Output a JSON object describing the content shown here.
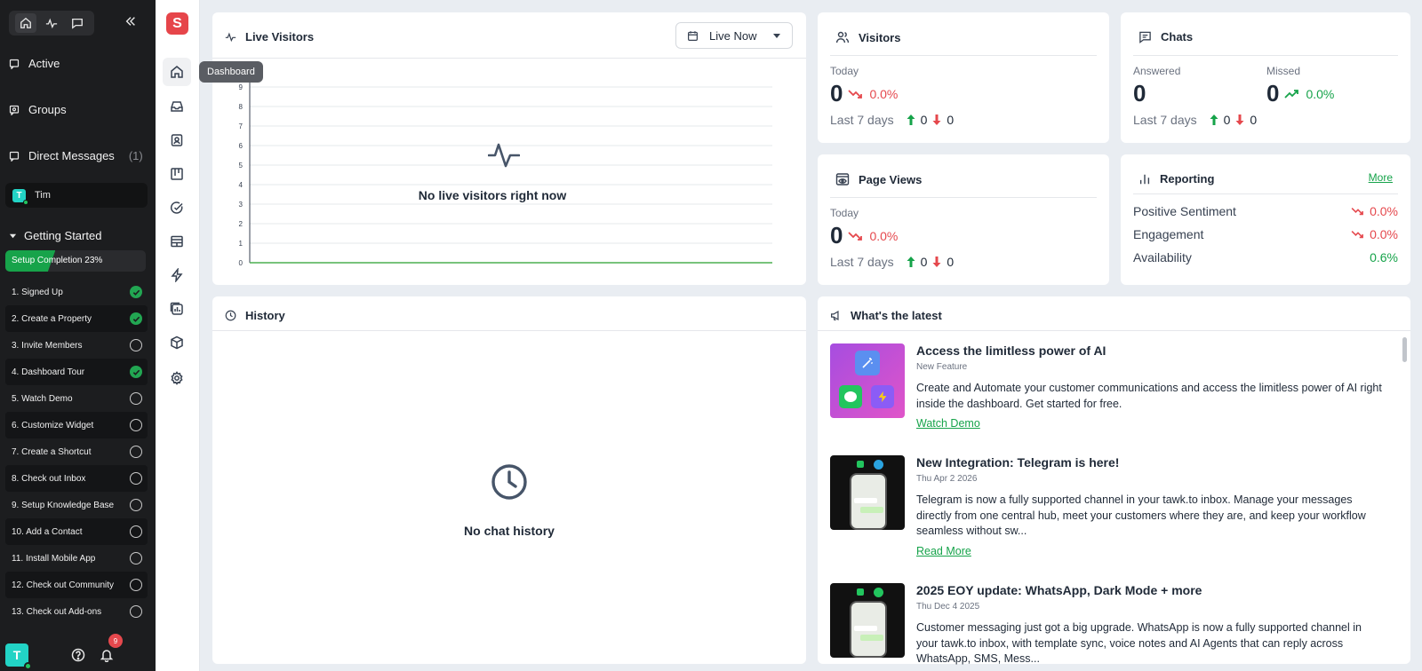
{
  "sidebar": {
    "nav": [
      {
        "label": "Active",
        "count": ""
      },
      {
        "label": "Groups",
        "count": ""
      },
      {
        "label": "Direct Messages",
        "count": "(1)"
      }
    ],
    "dm_user": {
      "initial": "T",
      "name": "Tim"
    },
    "getting_started": {
      "title": "Getting Started",
      "progress_label": "Setup Completion 23%",
      "progress_percent": 23,
      "steps": [
        {
          "label": "1. Signed Up",
          "done": true
        },
        {
          "label": "2. Create a Property",
          "done": true
        },
        {
          "label": "3. Invite Members",
          "done": false
        },
        {
          "label": "4. Dashboard Tour",
          "done": true
        },
        {
          "label": "5. Watch Demo",
          "done": false
        },
        {
          "label": "6. Customize Widget",
          "done": false
        },
        {
          "label": "7. Create a Shortcut",
          "done": false
        },
        {
          "label": "8. Check out Inbox",
          "done": false
        },
        {
          "label": "9. Setup Knowledge Base",
          "done": false
        },
        {
          "label": "10. Add a Contact",
          "done": false
        },
        {
          "label": "11. Install Mobile App",
          "done": false
        },
        {
          "label": "12. Check out Community",
          "done": false
        },
        {
          "label": "13. Check out Add-ons",
          "done": false
        }
      ]
    },
    "user_initial": "T",
    "notification_count": "9"
  },
  "rail": {
    "logo": "S",
    "tooltip": "Dashboard",
    "icons": [
      "home-icon",
      "inbox-icon",
      "contacts-icon",
      "board-icon",
      "tasks-icon",
      "knowledge-base-icon",
      "shortcuts-icon",
      "reports-icon",
      "addons-icon",
      "settings-icon"
    ]
  },
  "live_visitors": {
    "title": "Live Visitors",
    "dropdown": "Live Now",
    "empty": "No live visitors right now",
    "y_ticks": [
      "0",
      "1",
      "2",
      "3",
      "4",
      "5",
      "6",
      "7",
      "8",
      "9"
    ]
  },
  "visitors": {
    "title": "Visitors",
    "today_label": "Today",
    "today_value": "0",
    "today_change": "0.0%",
    "last7_label": "Last 7 days",
    "last7_up": "0",
    "last7_down": "0"
  },
  "chats": {
    "title": "Chats",
    "answered_label": "Answered",
    "answered_value": "0",
    "missed_label": "Missed",
    "missed_value": "0",
    "missed_change": "0.0%",
    "last7_label": "Last 7 days",
    "last7_up": "0",
    "last7_down": "0"
  },
  "page_views": {
    "title": "Page Views",
    "today_label": "Today",
    "today_value": "0",
    "today_change": "0.0%",
    "last7_label": "Last 7 days",
    "last7_up": "0",
    "last7_down": "0"
  },
  "reporting": {
    "title": "Reporting",
    "more": "More",
    "rows": [
      {
        "label": "Positive Sentiment",
        "value": "0.0%",
        "trend": "down"
      },
      {
        "label": "Engagement",
        "value": "0.0%",
        "trend": "down"
      },
      {
        "label": "Availability",
        "value": "0.6%",
        "trend": "none"
      }
    ]
  },
  "history": {
    "title": "History",
    "empty": "No chat history"
  },
  "latest": {
    "title": "What's the latest",
    "items": [
      {
        "title": "Access the limitless power of AI",
        "tag": "New Feature",
        "text": "Create and Automate your customer communications and access the limitless power of AI right inside the dashboard. Get started for free.",
        "link": "Watch Demo"
      },
      {
        "title": "New Integration: Telegram is here!",
        "tag": "Thu Apr 2 2026",
        "text": "Telegram is now a fully supported channel in your tawk.to inbox. Manage your messages directly from one central hub, meet your customers where they are, and keep your workflow seamless without sw...",
        "link": "Read More"
      },
      {
        "title": "2025 EOY update: WhatsApp, Dark Mode + more",
        "tag": "Thu Dec 4 2025",
        "text": "Customer messaging just got a big upgrade. WhatsApp is now a fully supported channel in your tawk.to inbox, with template sync, voice notes and AI Agents that can reply across WhatsApp, SMS, Mess...",
        "link": ""
      }
    ]
  },
  "colors": {
    "brand": "#e6454a",
    "accent_green": "#16a34a",
    "down_red": "#e5484d",
    "sidebar_bg": "#1c1d1f"
  }
}
